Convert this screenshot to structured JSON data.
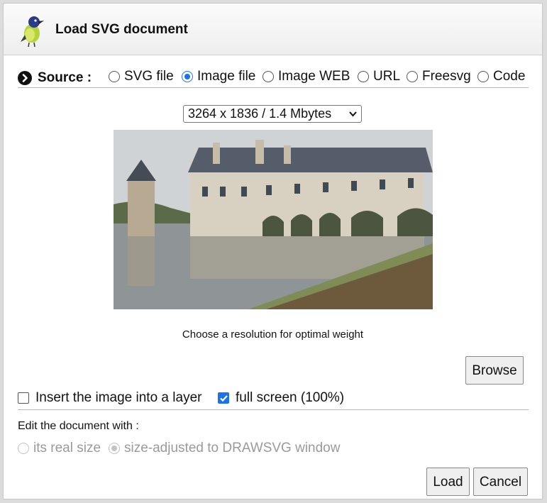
{
  "dialog": {
    "title": "Load SVG document"
  },
  "source": {
    "label": "Source :",
    "options": [
      {
        "label": "SVG file",
        "checked": false
      },
      {
        "label": "Image file",
        "checked": true
      },
      {
        "label": "Image WEB",
        "checked": false
      },
      {
        "label": "URL",
        "checked": false
      },
      {
        "label": "Freesvg",
        "checked": false
      },
      {
        "label": "Code",
        "checked": false
      }
    ]
  },
  "resolution": {
    "selected": "3264 x 1836 / 1.4 Mbytes"
  },
  "hint": "Choose a resolution for optimal weight",
  "browse_label": "Browse",
  "options": {
    "insert_layer": {
      "label": "Insert the image into a layer",
      "checked": false
    },
    "full_screen": {
      "label": "full screen (100%)",
      "checked": true
    }
  },
  "edit": {
    "label": "Edit the document with :",
    "real_size": {
      "label": "its real size",
      "checked": false,
      "disabled": true
    },
    "adjusted": {
      "label": "size-adjusted to DRAWSVG window",
      "checked": true,
      "disabled": true
    }
  },
  "buttons": {
    "load": "Load",
    "cancel": "Cancel"
  },
  "colors": {
    "accent": "#1a73e8",
    "disabled": "#9a9a9a"
  }
}
